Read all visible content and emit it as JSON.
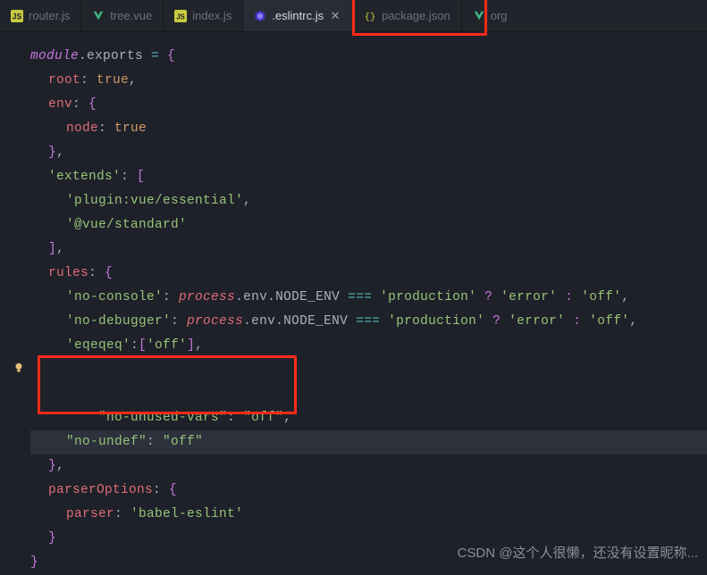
{
  "tabs": [
    {
      "label": "router.js",
      "icon": "js"
    },
    {
      "label": "tree.vue",
      "icon": "vue"
    },
    {
      "label": "index.js",
      "icon": "js-badge"
    },
    {
      "label": ".eslintrc.js",
      "icon": "eslint",
      "active": true
    },
    {
      "label": "package.json",
      "icon": "json"
    },
    {
      "label": "org",
      "icon": "vue"
    }
  ],
  "code": {
    "module": "module",
    "exports": ".exports",
    "eq": " = ",
    "root": "root",
    "true": "true",
    "env": "env",
    "node": "node",
    "extends": "'extends'",
    "plugin_vue": "'plugin:vue/essential'",
    "vue_standard": "'@vue/standard'",
    "rules": "rules",
    "no_console": "'no-console'",
    "no_debugger": "'no-debugger'",
    "process": "process",
    "envprop": ".env.NODE_ENV",
    "tripeq": " === ",
    "production": "'production'",
    "qmark": " ? ",
    "error": "'error'",
    "colon_sp": " : ",
    "off": "'off'",
    "eqeqeq": "'eqeqeq'",
    "no_unused_vars_dq": "\"no-unused-vars\"",
    "no_undef_dq": "\"no-undef\"",
    "off_dq": "\"off\"",
    "parserOptions": "parserOptions",
    "parser": "parser",
    "babel_eslint": "'babel-eslint'"
  },
  "watermark": "CSDN @这个人很懒，还没有设置昵称..."
}
